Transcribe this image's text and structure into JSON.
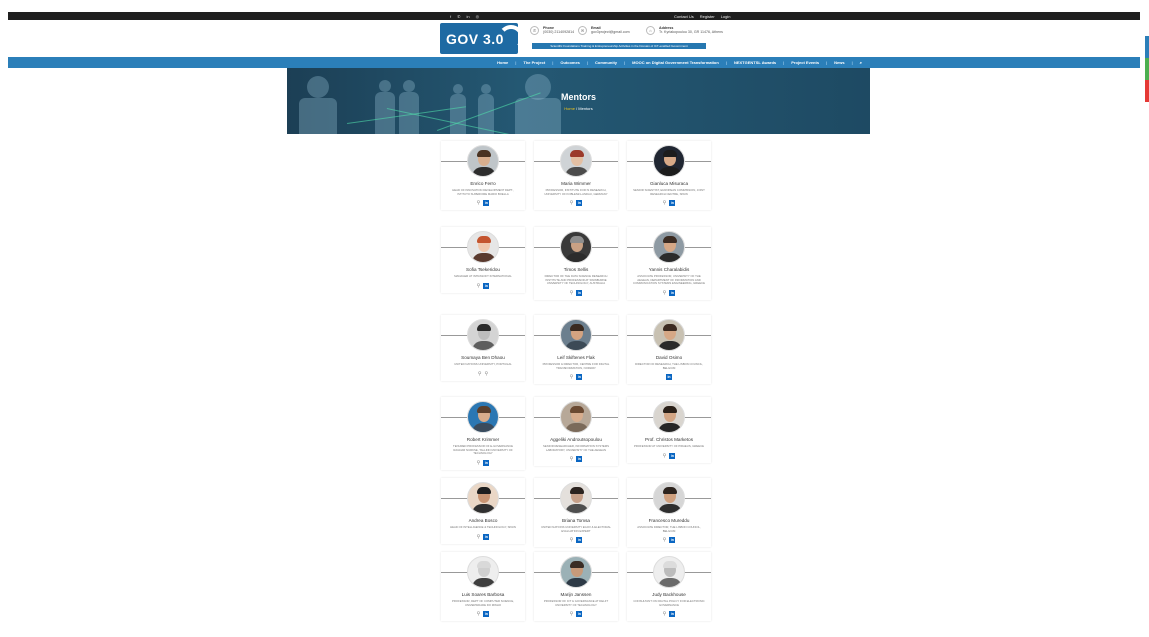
{
  "topbar": {
    "social": [
      "f",
      "✆",
      "in",
      "◎"
    ],
    "auth": [
      "Contact Us",
      "Register",
      "Login"
    ]
  },
  "header": {
    "logo": "GOV 3.0",
    "contacts": [
      {
        "icon": "phone-icon",
        "label": "Phone",
        "value": "(0030) 2114092814"
      },
      {
        "icon": "email-icon",
        "label": "Email",
        "value": "gov3project@gmail.com"
      },
      {
        "icon": "address-icon",
        "label": "Address",
        "value": "Tr. Kyriakopoulou 30, GR 11476, Athens"
      }
    ],
    "tagline": "Scientific Foundations Training & Entrepreneurship Activities in the Domain of ICT-enabled Government"
  },
  "nav": {
    "items": [
      "Home",
      "The Project",
      "Outcomes",
      "Community",
      "MOOC on Digital Government Transformation",
      "NEXTGENTSL Awards",
      "Project Events",
      "News"
    ],
    "search_icon": "search-icon"
  },
  "hero": {
    "title": "Mentors",
    "crumb_home": "Home",
    "crumb_current": "Mentors"
  },
  "colors": {
    "nav": "#2b7fb9",
    "topbar": "#1f1f1f",
    "linkedin": "#0a66c2",
    "side_tabs": [
      "#2b7fb9",
      "#4caf50",
      "#e53935"
    ]
  },
  "mentors": [
    {
      "name": "Enrico Ferro",
      "role": "Head of Innovation Development Dept., Istituto Superiore Mario Boella",
      "icons": "link-linkedin",
      "skin": "#d8ae8e",
      "hair": "#4a3323",
      "body": "#2d2d2d",
      "bg": "#bfc5c9"
    },
    {
      "name": "Maria Wimmer",
      "role": "Professor, Institute for IS Research, University of Koblenz-Landau, Germany",
      "icons": "link-linkedin",
      "skin": "#e3bfa3",
      "hair": "#9b3a2b",
      "body": "#4b4b4b",
      "bg": "#cfd3d6"
    },
    {
      "name": "Gianluca Misuraca",
      "role": "Senior Scientist, European Commission, Joint Research Centre, Spain",
      "icons": "link-linkedin",
      "skin": "#d7a987",
      "hair": "#1c1c1c",
      "body": "#1c1c1c",
      "bg": "#202632"
    },
    {
      "name": "Sofia Tsekeridou",
      "role": "Manager at Intrasoft International",
      "icons": "link-linkedin",
      "skin": "#f0c8ae",
      "hair": "#c4552f",
      "body": "#5a3a2e",
      "bg": "#e6e6e6"
    },
    {
      "name": "Timos Sellis",
      "role": "Director of the Data Science Research Institute and Professor at Swinburne University of Technology, Australia",
      "icons": "link-linkedin",
      "skin": "#c9a184",
      "hair": "#8e8e8e",
      "body": "#2c2c2c",
      "bg": "#3a3a3a"
    },
    {
      "name": "Yannis Charalabidis",
      "role": "Associate Professor, University of the Aegean, Department of Information and Communication Systems Engineering, Greece",
      "icons": "link-linkedin",
      "skin": "#d5a786",
      "hair": "#3b2b22",
      "body": "#2b2b2b",
      "bg": "#8e9aa3"
    },
    {
      "name": "Soumaya Ben Dhaou",
      "role": "United Nations University, Portugal",
      "icons": "link-link",
      "skin": "#bdbdbd",
      "hair": "#2a2a2a",
      "body": "#5e5e5e",
      "bg": "#d4d4d4"
    },
    {
      "name": "Leif Skiftenes Flak",
      "role": "Professor & Director, Centre for Digital Transformation, Norway",
      "icons": "link-linkedin",
      "skin": "#d3a381",
      "hair": "#3a2a20",
      "body": "#3c4a56",
      "bg": "#6c7f8e"
    },
    {
      "name": "David Osimo",
      "role": "Director of Research, The Lisbon Council, Belgium",
      "icons": "linkedin",
      "skin": "#d6a886",
      "hair": "#3d2b21",
      "body": "#2a2a2a",
      "bg": "#c8c1b2"
    },
    {
      "name": "Robert Krimmer",
      "role": "Tenured Professor of e-Governance Ragnar Nurkse, Tallinn University of Technology",
      "icons": "link-linkedin",
      "skin": "#d8ad8c",
      "hair": "#5a3f2c",
      "body": "#3b4b5c",
      "bg": "#2b77b3"
    },
    {
      "name": "Aggeliki Androutsopoulou",
      "role": "Senior Researcher, Information Systems Laboratory, University of the Aegean",
      "icons": "link-linkedin",
      "skin": "#d7ad8e",
      "hair": "#6b4a32",
      "body": "#7b6a5a",
      "bg": "#b7a898"
    },
    {
      "name": "Prof. Christos Marketos",
      "role": "Professor at University of Piraeus, Greece",
      "icons": "link-linkedin",
      "skin": "#d2a584",
      "hair": "#2a2018",
      "body": "#262626",
      "bg": "#d9d5cf"
    },
    {
      "name": "Andrea Bosco",
      "role": "Head of Intelligence & Technology, Spain",
      "icons": "link-linkedin",
      "skin": "#c99573",
      "hair": "#1f1f1f",
      "body": "#303030",
      "bg": "#ead7c6"
    },
    {
      "name": "Briana Tomsa",
      "role": "United Nations University EGOV & Electoral Evaluation Expert",
      "icons": "link-linkedin",
      "skin": "#c6a089",
      "hair": "#2b231f",
      "body": "#4e4e4e",
      "bg": "#e4e0dc"
    },
    {
      "name": "Francesco Mureddu",
      "role": "Associate Director, The Lisbon Council, Belgium",
      "icons": "link-linkedin",
      "skin": "#d0a17f",
      "hair": "#2d241e",
      "body": "#2e2e2e",
      "bg": "#d6d6d6"
    },
    {
      "name": "Luis Soares Barbosa",
      "role": "Professor, Dept of Computer Science, Universidade do Minho",
      "icons": "link-linkedin",
      "skin": "#cfcfcf",
      "hair": "#d9d9d9",
      "body": "#3f3f3f",
      "bg": "#eeeeee"
    },
    {
      "name": "Marijn Janssen",
      "role": "Professor of ICT & Governance at Delft University of Technology",
      "icons": "link-linkedin",
      "skin": "#c79a7a",
      "hair": "#3a2d25",
      "body": "#2e3a46",
      "bg": "#9bb1b6"
    },
    {
      "name": "Judy Backhouse",
      "role": "Consultant on Digital Policy for Electronic Governance",
      "icons": "link-linkedin",
      "skin": "#bcbcbc",
      "hair": "#dcdcdc",
      "body": "#6b6b6b",
      "bg": "#eeeeee"
    }
  ]
}
